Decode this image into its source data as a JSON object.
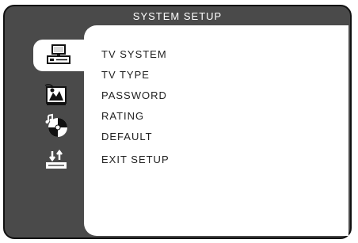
{
  "window": {
    "title": "SYSTEM SETUP"
  },
  "sidebar": {
    "tabs": [
      {
        "icon": "computer-icon",
        "active": true
      },
      {
        "icon": "tv-picture-icon",
        "active": false
      },
      {
        "icon": "audio-disc-icon",
        "active": false
      },
      {
        "icon": "transfer-device-icon",
        "active": false
      }
    ]
  },
  "menu": {
    "items": [
      {
        "label": "TV SYSTEM"
      },
      {
        "label": "TV TYPE"
      },
      {
        "label": "PASSWORD"
      },
      {
        "label": "RATING"
      },
      {
        "label": "DEFAULT"
      },
      {
        "label": "EXIT SETUP"
      }
    ]
  },
  "colors": {
    "frame": "#4a4a4a",
    "panel": "#ffffff",
    "text": "#222222",
    "title_text": "#ffffff"
  }
}
